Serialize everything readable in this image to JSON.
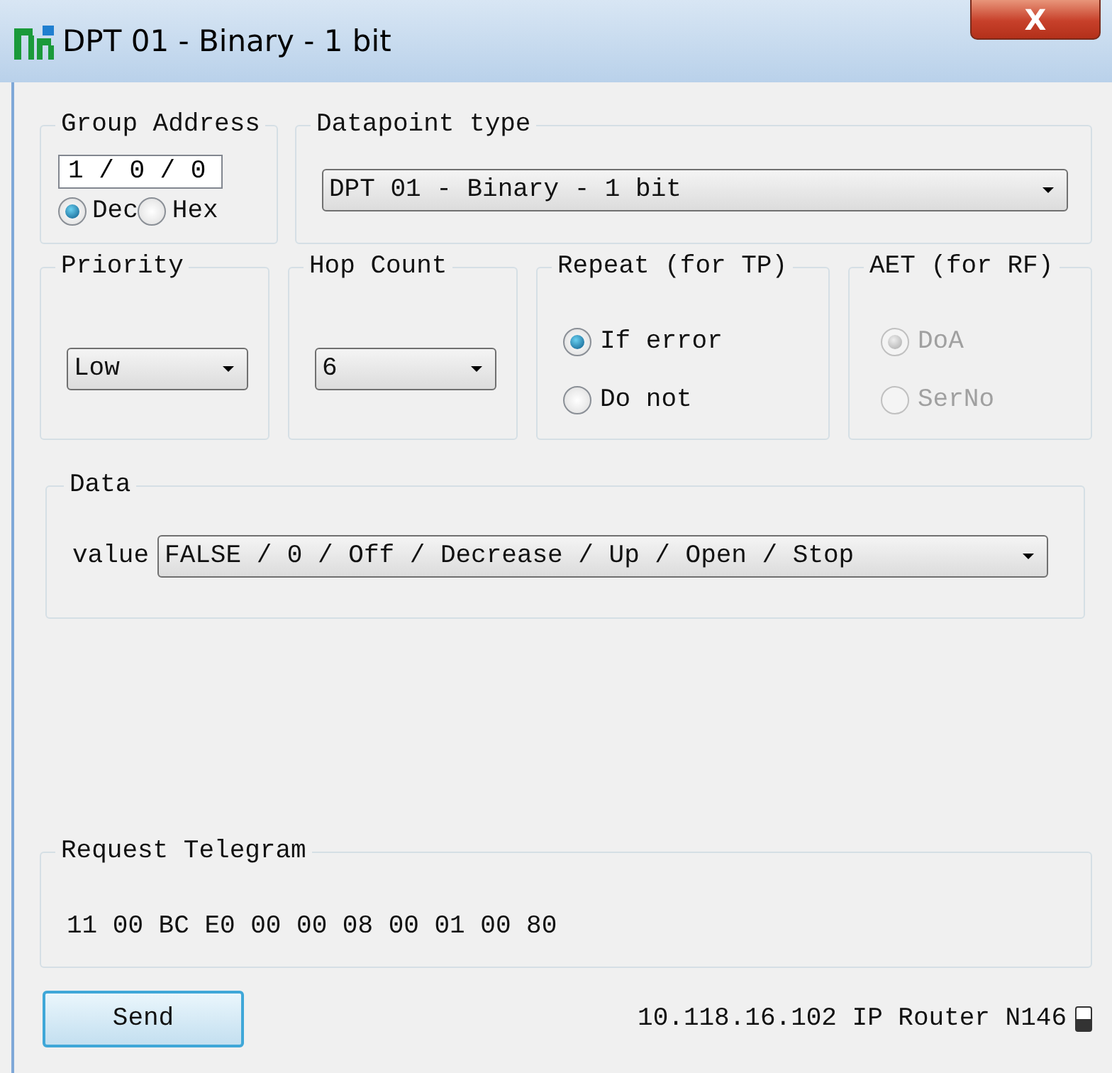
{
  "window": {
    "title": "DPT 01 - Binary - 1 bit",
    "close": "X"
  },
  "group_address": {
    "title": "Group Address",
    "value": "1 / 0 / 0",
    "formats": [
      {
        "label": "Dec",
        "selected": true
      },
      {
        "label": "Hex",
        "selected": false
      }
    ]
  },
  "datapoint_type": {
    "title": "Datapoint type",
    "value": "DPT 01 - Binary - 1 bit"
  },
  "priority": {
    "title": "Priority",
    "value": "Low"
  },
  "hop_count": {
    "title": "Hop Count",
    "value": "6"
  },
  "repeat": {
    "title": "Repeat (for TP)",
    "options": [
      {
        "label": "If error",
        "selected": true,
        "disabled": false
      },
      {
        "label": "Do not",
        "selected": false,
        "disabled": false
      }
    ]
  },
  "aet": {
    "title": "AET (for RF)",
    "options": [
      {
        "label": "DoA",
        "selected": true,
        "disabled": true
      },
      {
        "label": "SerNo",
        "selected": false,
        "disabled": true
      }
    ]
  },
  "data": {
    "title": "Data",
    "label": "value",
    "value": "FALSE / 0 / Off / Decrease / Up / Open / Stop"
  },
  "request_telegram": {
    "title": "Request Telegram",
    "bytes": "11 00 BC E0 00 00 08 00 01 00 80"
  },
  "send_button": "Send",
  "interface": "10.118.16.102 IP Router N146"
}
